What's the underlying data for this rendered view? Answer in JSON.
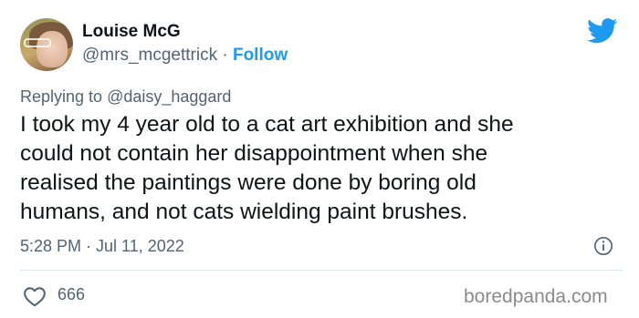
{
  "author": {
    "name": "Louise McG",
    "handle": "@mrs_mcgettrick",
    "separator": "·",
    "follow_label": "Follow"
  },
  "reply": {
    "prefix": "Replying to",
    "mention": "@daisy_haggard"
  },
  "tweet": {
    "lines": [
      "I took my 4 year old to a cat art exhibition and she",
      "could not contain her disappointment when she",
      "realised the paintings were done by boring old",
      "humans, and not cats wielding paint brushes."
    ]
  },
  "timestamp": "5:28 PM · Jul 11, 2022",
  "likes": "666",
  "watermark": "boredpanda.com",
  "icons": {
    "platform": "twitter-bird-icon",
    "info": "info-icon",
    "like": "heart-icon"
  },
  "colors": {
    "brand_blue": "#1d9bf0",
    "text_primary": "#0f1419",
    "text_secondary": "#536471",
    "divider": "#e1e8ed"
  }
}
